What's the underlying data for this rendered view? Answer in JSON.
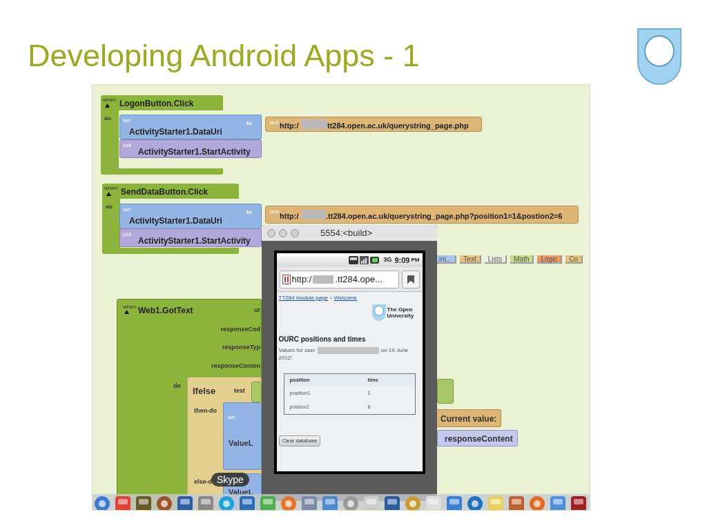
{
  "slide": {
    "title": "Developing Android Apps - 1"
  },
  "editor": {
    "event_blocks": [
      {
        "when": "when",
        "event": "LogonButton.Click",
        "do": "do",
        "set": "set",
        "property": "ActivityStarter1.DataUri",
        "to": "to",
        "text_keyword": "text",
        "url_start": "http:/",
        "url_end": "tt284.open.ac.uk/querystring_page.php",
        "call": "call",
        "method": "ActivityStarter1.StartActivity"
      },
      {
        "when": "when",
        "event": "SendDataButton.Click",
        "do": "do",
        "set": "set",
        "property": "ActivityStarter1.DataUri",
        "to": "to",
        "text_keyword": "text",
        "url_start": "http:/",
        "url_end": ".tt284.open.ac.uk/querystring_page.php?position1=1&postion2=6",
        "call": "call",
        "method": "ActivityStarter1.StartActivity"
      }
    ],
    "drawer_tabs": [
      {
        "label": "ini...",
        "color": "#a9c8f0"
      },
      {
        "label": "Text",
        "color": "#e3c37e"
      },
      {
        "label": "Lists",
        "color": "#eef0e4"
      },
      {
        "label": "Math",
        "color": "#c8dc8c"
      },
      {
        "label": "Logic",
        "color": "#e99a6e"
      },
      {
        "label": "Co",
        "color": "#e3c37e"
      }
    ],
    "gottext_block": {
      "when": "when",
      "event": "Web1.GotText",
      "params": [
        "ur",
        "responseCod",
        "responseTyp",
        "responseConten"
      ],
      "do": "do",
      "ifelse": "Ifelse",
      "test": "test",
      "then_do": "then-do",
      "set": "set",
      "set_target": "ValueL",
      "else_do": "else-d",
      "else_target": "ValueL"
    },
    "loose_blocks": [
      {
        "kind": "text",
        "label": "Current value:"
      },
      {
        "kind": "variable",
        "label": "responseContent"
      }
    ]
  },
  "emulator": {
    "title": "5554:<build>",
    "network": "3G",
    "time": "9:09",
    "meridiem": "PM",
    "url_start": "http:/",
    "url_end": ".tt284.ope...",
    "breadcrumb": {
      "link": "TT284 module page",
      "separator": "<",
      "current": "Welcome"
    },
    "logo_text": "The Open University",
    "heading": "OURC positions and times",
    "values_before": "Values for user",
    "values_after": "on 19 June 2012:",
    "table": {
      "columns": [
        "position",
        "time"
      ],
      "rows": [
        [
          "position1",
          "1"
        ],
        [
          "postion2",
          "6"
        ]
      ]
    },
    "button": "Clear database"
  },
  "dock": {
    "tooltip": "Skype"
  }
}
